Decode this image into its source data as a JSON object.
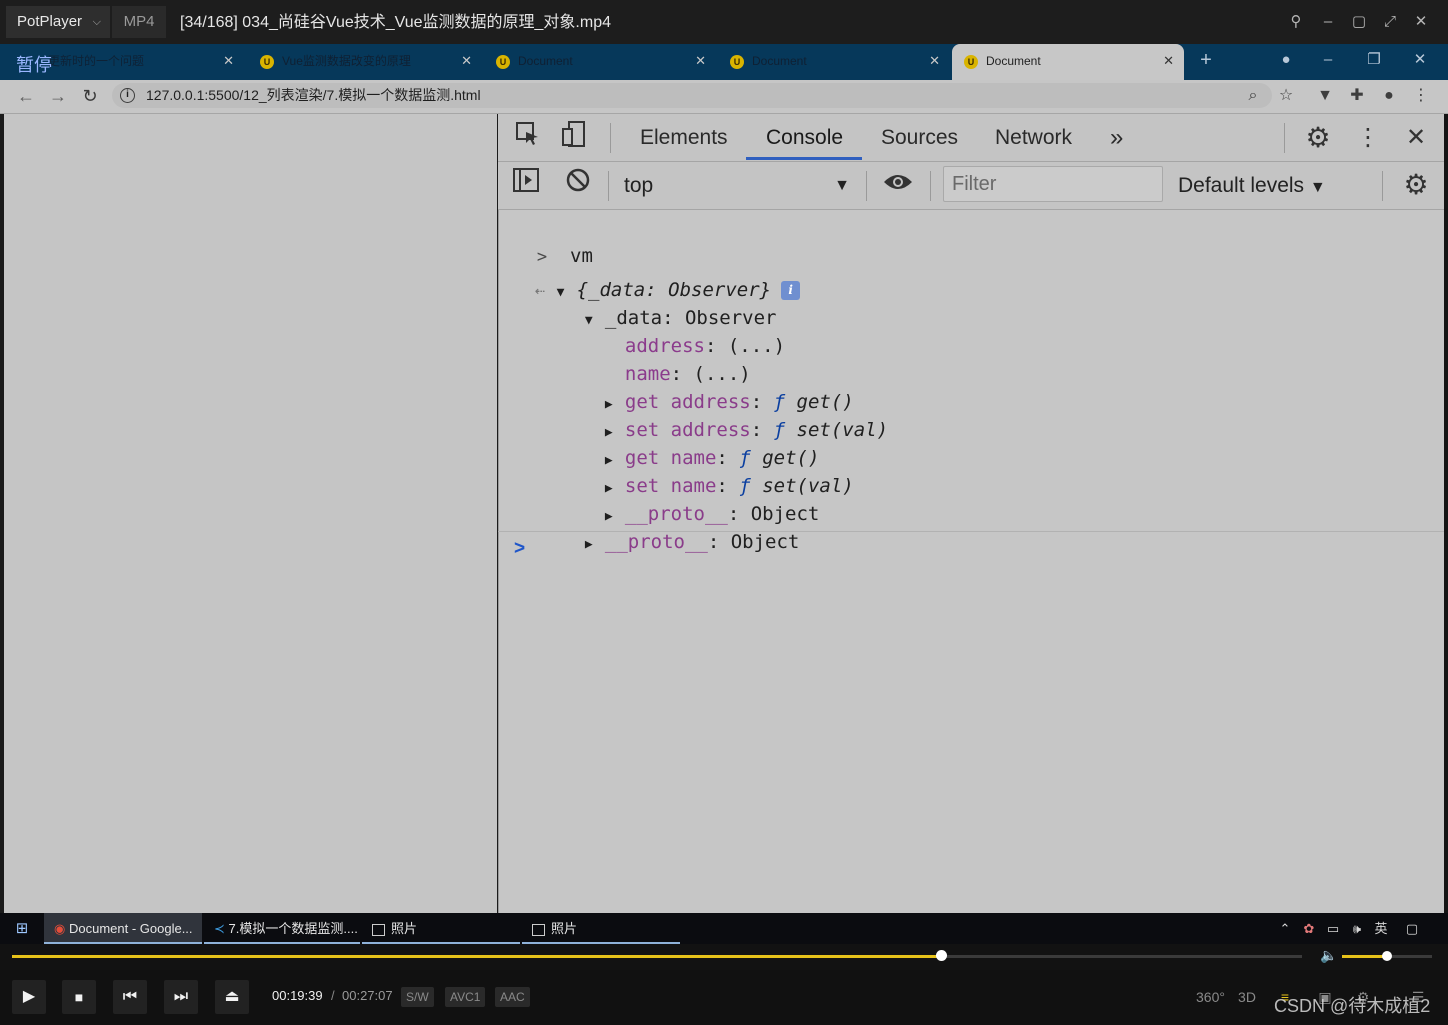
{
  "player": {
    "app_name": "PotPlayer",
    "format": "MP4",
    "file_title": "[34/168] 034_尚硅谷Vue技术_Vue监测数据的原理_对象.mp4",
    "status_overlay": "暂停",
    "time_current": "00:19:39",
    "time_separator": "/",
    "time_total": "00:27:07",
    "chips": [
      "S/W",
      "AVC1",
      "AAC"
    ],
    "right_buttons": [
      "360°",
      "3D"
    ],
    "progress_fraction": 0.72,
    "volume_fraction": 0.5,
    "watermark": "CSDN @待木成植2"
  },
  "browser": {
    "tabs": [
      {
        "label": "更新时的一个问题",
        "icon": "vue-icon"
      },
      {
        "label": "Vue监测数据改变的原理",
        "icon": "vue-icon"
      },
      {
        "label": "Document",
        "icon": "vue-icon"
      },
      {
        "label": "Document",
        "icon": "vue-icon"
      },
      {
        "label": "Document",
        "icon": "vue-icon",
        "active": true
      }
    ],
    "new_tab": "+",
    "url": "127.0.0.1:5500/12_列表渲染/7.模拟一个数据监测.html"
  },
  "devtools": {
    "tabs": [
      "Elements",
      "Console",
      "Sources",
      "Network"
    ],
    "active_tab": "Console",
    "more": "»",
    "context": "top",
    "filter_placeholder": "Filter",
    "levels": "Default levels",
    "console": {
      "input": "vm",
      "result_summary_open": "{",
      "result_summary_key": "_data",
      "result_summary_rest": ": Observer}",
      "data_key": "_data",
      "data_type": ": Observer",
      "rows": [
        {
          "key": "address",
          "rest": ": (...)"
        },
        {
          "key": "name",
          "rest": ": (...)"
        }
      ],
      "accessors": [
        {
          "key": "get address",
          "f": "ƒ",
          "sig": "get()"
        },
        {
          "key": "set address",
          "f": "ƒ",
          "sig": "set(val)"
        },
        {
          "key": "get name",
          "f": "ƒ",
          "sig": "get()"
        },
        {
          "key": "set name",
          "f": "ƒ",
          "sig": "set(val)"
        }
      ],
      "inner_proto_key": "__proto__",
      "inner_proto_type": ": Object",
      "outer_proto_key": "__proto__",
      "outer_proto_type": ": Object"
    }
  },
  "taskbar": {
    "items": [
      {
        "label": "Document - Google..."
      },
      {
        "label": "7.模拟一个数据监测...."
      },
      {
        "label": "照片"
      },
      {
        "label": "照片"
      }
    ],
    "ime": "英"
  },
  "colors": {
    "accent": "#2f5fbf",
    "progress": "#e6c21a",
    "tab_strip": "#06385a"
  }
}
